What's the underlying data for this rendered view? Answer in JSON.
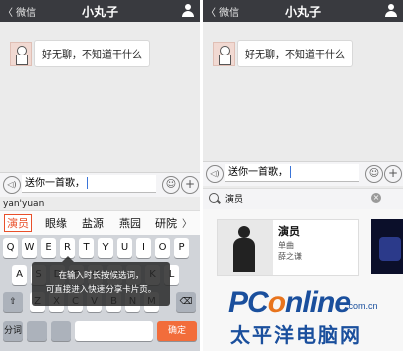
{
  "left": {
    "header": {
      "back": "〈 微信",
      "title": "小丸子"
    },
    "message": "好无聊，不知道干什么",
    "input_value": "送你一首歌，",
    "pinyin": "yan'yuan",
    "candidates": [
      "演员",
      "眼缘",
      "盐源",
      "燕园",
      "研院"
    ],
    "keys_row1": [
      "Q",
      "W",
      "E",
      "R",
      "T",
      "Y",
      "U",
      "I",
      "O",
      "P"
    ],
    "keys_row2": [
      "A",
      "S",
      "D",
      "F",
      "G",
      "H",
      "J",
      "K",
      "L"
    ],
    "keys_row3": [
      "Z",
      "X",
      "C",
      "V",
      "B",
      "N",
      "M"
    ],
    "shift_label": "⇧",
    "delete_label": "⌫",
    "split_label": "分词",
    "done_label": "确定",
    "tooltip_line1": "在输入时长按候选词，",
    "tooltip_line2": "可直接进入快速分享卡片页。"
  },
  "right": {
    "header": {
      "back": "〈 微信",
      "title": "小丸子"
    },
    "message": "好无聊，不知道干什么",
    "input_value": "送你一首歌，",
    "search_value": "演员",
    "clear_icon": "×",
    "card": {
      "title": "演员",
      "line1": "单曲",
      "line2": "薛之谦"
    }
  },
  "icons": {
    "voice": "◁)",
    "emoji": "☺",
    "plus": "+",
    "chevron": "〉"
  },
  "watermark": {
    "main_p": "PC",
    "main_o": "o",
    "main_rest": "nline",
    "domain": ".com.cn",
    "sub": "太平洋电脑网"
  }
}
